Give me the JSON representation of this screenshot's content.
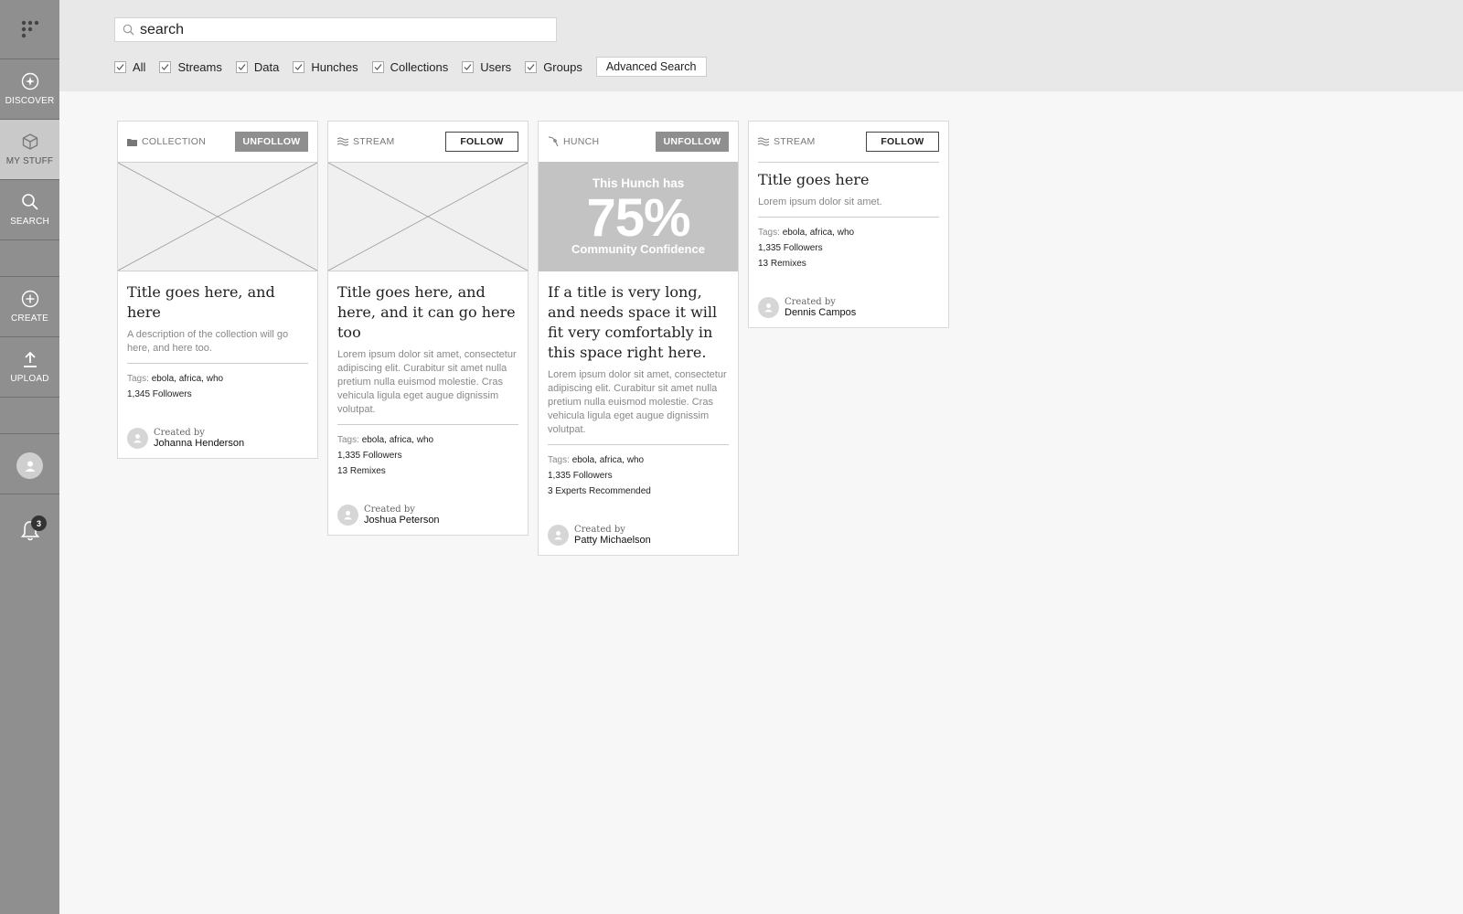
{
  "sidebar": {
    "items": [
      {
        "label": "DISCOVER",
        "icon": "compass-icon"
      },
      {
        "label": "MY STUFF",
        "icon": "box-icon"
      },
      {
        "label": "SEARCH",
        "icon": "search-icon"
      },
      {
        "label": "CREATE",
        "icon": "plus-circle-icon"
      },
      {
        "label": "UPLOAD",
        "icon": "upload-icon"
      }
    ],
    "notification_count": "3"
  },
  "search": {
    "value": "search",
    "placeholder": "search"
  },
  "filters": {
    "items": [
      "All",
      "Streams",
      "Data",
      "Hunches",
      "Collections",
      "Users",
      "Groups"
    ],
    "advanced_label": "Advanced Search"
  },
  "cards": [
    {
      "type": "COLLECTION",
      "action": "UNFOLLOW",
      "title": "Title goes here, and here",
      "description": "A description of the collection will go here, and here too.",
      "tags_label": "Tags:",
      "tags": "ebola, africa, who",
      "stats": [
        "1,345 Followers"
      ],
      "created_by_label": "Created by",
      "creator": "Johanna Henderson"
    },
    {
      "type": "STREAM",
      "action": "FOLLOW",
      "title": "Title goes here, and here, and it can go here too",
      "description": "Lorem ipsum dolor sit amet, consectetur adipiscing elit. Curabitur sit amet nulla pretium nulla euismod molestie. Cras vehicula ligula eget augue dignissim volutpat.",
      "tags_label": "Tags:",
      "tags": "ebola, africa, who",
      "stats": [
        "1,335 Followers",
        "13 Remixes"
      ],
      "created_by_label": "Created by",
      "creator": "Joshua Peterson"
    },
    {
      "type": "HUNCH",
      "action": "UNFOLLOW",
      "hunch_top": "This Hunch has",
      "hunch_pct": "75%",
      "hunch_bottom": "Community Confidence",
      "title": "If a title is very long, and needs space it will fit very comfortably in this space right here.",
      "description": "Lorem ipsum dolor sit amet, consectetur adipiscing elit. Curabitur sit amet nulla pretium nulla euismod molestie. Cras vehicula ligula eget augue dignissim volutpat.",
      "tags_label": "Tags:",
      "tags": "ebola, africa, who",
      "stats": [
        "1,335 Followers",
        "3 Experts Recommended"
      ],
      "created_by_label": "Created by",
      "creator": "Patty Michaelson"
    },
    {
      "type": "STREAM",
      "action": "FOLLOW",
      "title": "Title goes here",
      "description": "Lorem ipsum dolor sit amet.",
      "tags_label": "Tags:",
      "tags": "ebola, africa, who",
      "stats": [
        "1,335 Followers",
        "13 Remixes"
      ],
      "created_by_label": "Created by",
      "creator": "Dennis Campos"
    }
  ],
  "colors": {
    "sidebar": "#8f8f8f",
    "sidebar_active": "#c9c9c9",
    "topbar": "#e8e8e8",
    "unfollow_button": "#8f8f8f",
    "hunch_panel": "#c3c3c3"
  }
}
